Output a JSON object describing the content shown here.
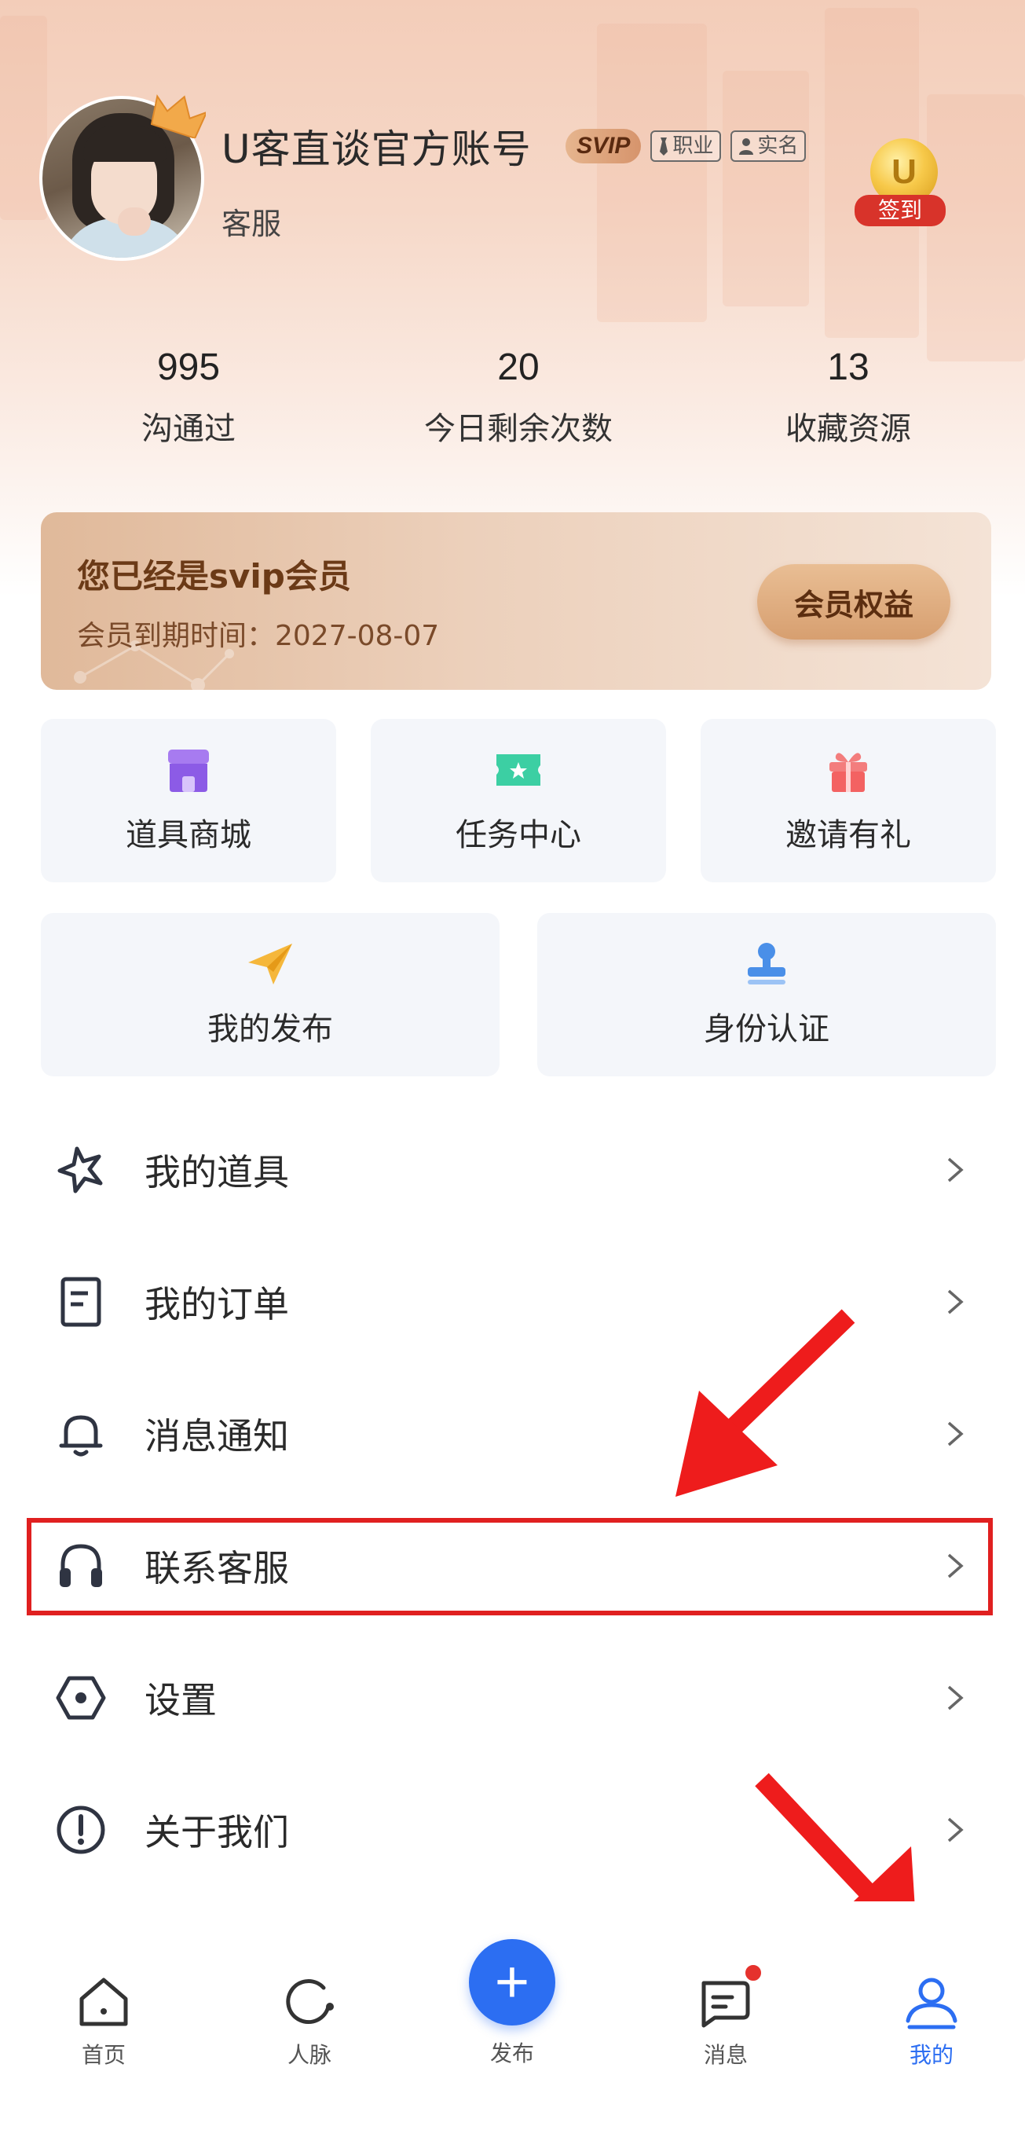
{
  "profile": {
    "name": "U客直谈官方账号",
    "subtitle": "客服",
    "badges": {
      "svip": "SVIP",
      "job": "职业",
      "verified": "实名"
    },
    "signin_label": "签到",
    "signin_coin": "U"
  },
  "stats": [
    {
      "value": "995",
      "label": "沟通过"
    },
    {
      "value": "20",
      "label": "今日剩余次数"
    },
    {
      "value": "13",
      "label": "收藏资源"
    }
  ],
  "vip": {
    "title": "您已经是svip会员",
    "expiry": "会员到期时间：2027-08-07",
    "button": "会员权益"
  },
  "tiles": [
    {
      "label": "道具商城",
      "icon": "shop-icon"
    },
    {
      "label": "任务中心",
      "icon": "ticket-icon"
    },
    {
      "label": "邀请有礼",
      "icon": "gift-icon"
    },
    {
      "label": "我的发布",
      "icon": "paper-plane-icon"
    },
    {
      "label": "身份认证",
      "icon": "stamp-icon"
    }
  ],
  "menu": [
    {
      "label": "我的道具",
      "icon": "star-burst-icon"
    },
    {
      "label": "我的订单",
      "icon": "order-icon"
    },
    {
      "label": "消息通知",
      "icon": "bell-icon"
    },
    {
      "label": "联系客服",
      "icon": "headset-icon"
    },
    {
      "label": "设置",
      "icon": "settings-hexagon-icon"
    },
    {
      "label": "关于我们",
      "icon": "info-exclamation-icon"
    }
  ],
  "nav": [
    {
      "label": "首页",
      "icon": "home-icon"
    },
    {
      "label": "人脉",
      "icon": "contacts-icon"
    },
    {
      "label": "发布",
      "icon": "plus-icon"
    },
    {
      "label": "消息",
      "icon": "message-icon"
    },
    {
      "label": "我的",
      "icon": "user-icon",
      "active": true
    }
  ],
  "colors": {
    "accent": "#2c6ef2",
    "annotation_red": "#e02020",
    "vip_text": "#6b3a17"
  }
}
